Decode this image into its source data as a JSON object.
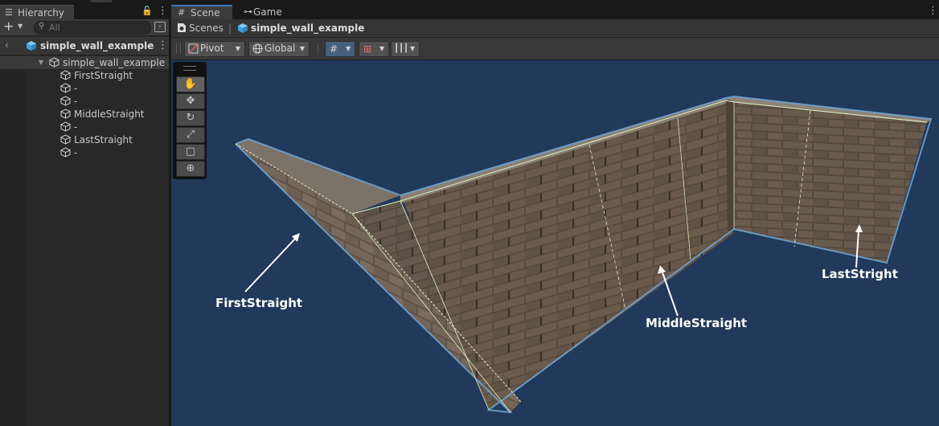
{
  "hierarchy": {
    "tab_title": "Hierarchy",
    "search_placeholder": "All",
    "scene_name": "simple_wall_example",
    "tree": [
      {
        "label": "simple_wall_example",
        "depth": 0
      },
      {
        "label": "FirstStraight",
        "depth": 1
      },
      {
        "label": "-",
        "depth": 1
      },
      {
        "label": "-",
        "depth": 1
      },
      {
        "label": "MiddleStraight",
        "depth": 1
      },
      {
        "label": "-",
        "depth": 1
      },
      {
        "label": "LastStraight",
        "depth": 1
      },
      {
        "label": "-",
        "depth": 1
      }
    ]
  },
  "scene_view": {
    "tabs": [
      {
        "label": "Scene",
        "active": true
      },
      {
        "label": "Game",
        "active": false
      }
    ],
    "breadcrumb": {
      "root": "Scenes",
      "current": "simple_wall_example"
    },
    "toolbar": {
      "pivot_label": "Pivot",
      "space_label": "Global"
    },
    "tools": [
      "hand",
      "move",
      "rotate",
      "scale",
      "rect",
      "transform"
    ],
    "annotations": [
      {
        "label": "FirstStraight"
      },
      {
        "label": "MiddleStraight"
      },
      {
        "label": "LastStright"
      }
    ]
  },
  "colors": {
    "viewport_bg": "#21395a",
    "accent": "#3a79bb",
    "annotation_text": "#ffffff",
    "selection_outline": "#dff0c0"
  }
}
